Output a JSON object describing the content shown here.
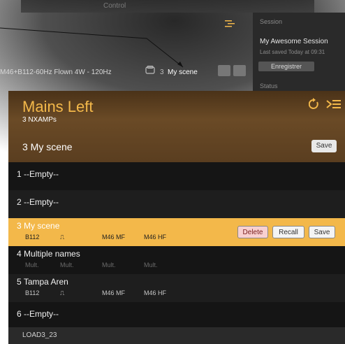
{
  "topbar": {
    "title": "Control"
  },
  "session": {
    "label": "Session",
    "name": "My Awesome Session",
    "saved": "Last saved Today at 09:31",
    "save_button": "Enregistrer",
    "status_label": "Status"
  },
  "toolbar": {
    "config": "M46+B112-60Hz Flown 4W - 120Hz",
    "scene_number": "3",
    "scene_name": "My scene"
  },
  "panel": {
    "title": "Mains Left",
    "subtitle": "3 NXAMPs",
    "current_scene": "3 My scene",
    "save_label": "Save"
  },
  "scenes": [
    {
      "num": "1",
      "name": "--Empty--",
      "slots": []
    },
    {
      "num": "2",
      "name": "--Empty--",
      "slots": []
    },
    {
      "num": "3",
      "name": "My scene",
      "slots": [
        "B112",
        "⎍",
        "M46 MF",
        "M46 HF"
      ],
      "selected": true
    },
    {
      "num": "4",
      "name": "Multiple names",
      "slots": [
        "Mult.",
        "Mult.",
        "Mult.",
        "Mult."
      ]
    },
    {
      "num": "5",
      "name": "Tampa Aren",
      "slots": [
        "B112",
        "⎍",
        "M46 MF",
        "M46 HF"
      ]
    },
    {
      "num": "6",
      "name": "--Empty--",
      "slots": []
    }
  ],
  "row_actions": {
    "delete": "Delete",
    "recall": "Recall",
    "save": "Save"
  },
  "footer": {
    "text": "LOAD3_23"
  },
  "colors": {
    "accent": "#f3b84a",
    "delete_bg": "#f8d0d0",
    "panel_bg": "#121212"
  }
}
